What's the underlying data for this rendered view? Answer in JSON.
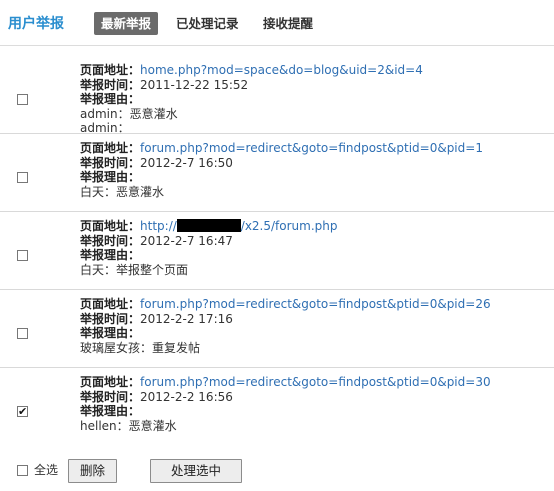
{
  "header": {
    "title": "用户举报",
    "tabs": [
      {
        "label": "最新举报",
        "active": true
      },
      {
        "label": "已处理记录",
        "active": false
      },
      {
        "label": "接收提醒",
        "active": false
      }
    ]
  },
  "labels": {
    "url": "页面地址：",
    "time": "举报时间：",
    "reason": "举报理由："
  },
  "reports": [
    {
      "checked": false,
      "url": "home.php?mod=space&do=blog&uid=2&id=4",
      "time": "2011-12-22 15:52",
      "reasons": [
        "admin：恶意灌水",
        "admin："
      ]
    },
    {
      "checked": false,
      "url": "forum.php?mod=redirect&goto=findpost&ptid=0&pid=1",
      "time": "2012-2-7 16:50",
      "reasons": [
        "白天：恶意灌水"
      ]
    },
    {
      "checked": false,
      "url_prefix": "http://",
      "url_suffix": "/x2.5/forum.php",
      "time": "2012-2-7 16:47",
      "reasons": [
        "白天：举报整个页面"
      ]
    },
    {
      "checked": false,
      "url": "forum.php?mod=redirect&goto=findpost&ptid=0&pid=26",
      "time": "2012-2-2 17:16",
      "reasons": [
        "玻璃屋女孩：重复发帖"
      ]
    },
    {
      "checked": true,
      "url": "forum.php?mod=redirect&goto=findpost&ptid=0&pid=30",
      "time": "2012-2-2 16:56",
      "reasons": [
        "hellen：恶意灌水"
      ]
    }
  ],
  "footer": {
    "select_all_label": "全选",
    "delete_label": "删除",
    "process_label": "处理选中"
  },
  "icons": {
    "checkmark": "✔"
  },
  "colors": {
    "title": "#2a8ecf",
    "active_tab_bg": "#6b6b6b",
    "link": "#2f6fb3"
  }
}
